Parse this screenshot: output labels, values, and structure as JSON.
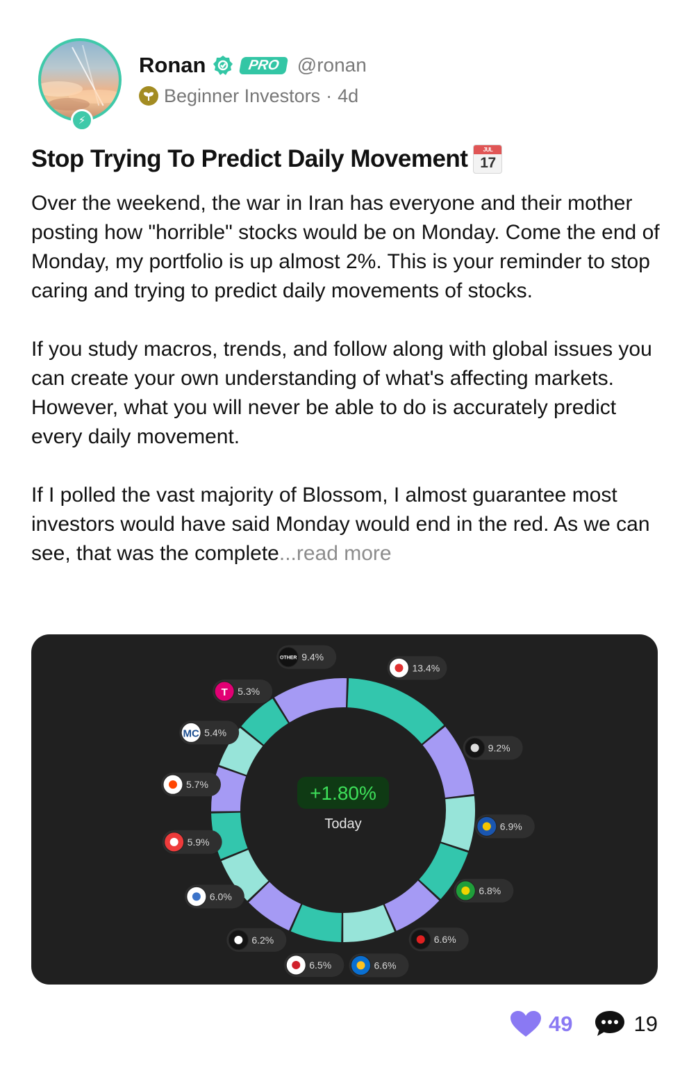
{
  "author": {
    "name": "Ronan",
    "badge": "PRO",
    "handle": "@ronan",
    "group": "Beginner Investors",
    "separator": "·",
    "age": "4d"
  },
  "post": {
    "title": "Stop Trying To Predict Daily Movement",
    "title_emoji": {
      "icon": "calendar-icon",
      "month": "JUL",
      "day": "17"
    },
    "paragraphs": [
      "Over the weekend, the war in Iran has everyone and their mother posting how \"horrible\" stocks would be on Monday. Come the end of Monday, my portfolio is up almost 2%. This is your reminder to stop caring and trying to predict daily movements of stocks.",
      "If you study macros, trends, and follow along with global issues you can create your own understanding of what's affecting markets. However, what you will never be able to do is accurately predict every daily movement.",
      "If I polled the vast majority of Blossom, I almost guarantee most investors would have said Monday would end in the red. As we can see, that was the complete"
    ],
    "read_more": "...read more"
  },
  "chart_data": {
    "type": "pie",
    "style": "donut",
    "center_value": "+1.80%",
    "center_label": "Today",
    "slices": [
      {
        "label": "13.4%",
        "value": 13.4,
        "logo": "red-swirl",
        "color": "#33c6ad"
      },
      {
        "label": "9.2%",
        "value": 9.2,
        "logo": "dark-circle",
        "color": "#a59af4"
      },
      {
        "label": "6.9%",
        "value": 6.9,
        "logo": "blue-square",
        "color": "#97e4d9"
      },
      {
        "label": "6.8%",
        "value": 6.8,
        "logo": "green-circle",
        "color": "#33c6ad"
      },
      {
        "label": "6.6%",
        "value": 6.6,
        "logo": "red-flame",
        "color": "#a59af4"
      },
      {
        "label": "6.6%",
        "value": 6.6,
        "logo": "walmart-spark",
        "color": "#97e4d9"
      },
      {
        "label": "6.5%",
        "value": 6.5,
        "logo": "red-white-logo",
        "color": "#33c6ad"
      },
      {
        "label": "6.2%",
        "value": 6.2,
        "logo": "amazon-a",
        "color": "#a59af4"
      },
      {
        "label": "6.0%",
        "value": 6.0,
        "logo": "ge-logo",
        "color": "#97e4d9"
      },
      {
        "label": "5.9%",
        "value": 5.9,
        "logo": "wsp-logo",
        "color": "#33c6ad"
      },
      {
        "label": "5.7%",
        "value": 5.7,
        "logo": "reddit-logo",
        "color": "#a59af4"
      },
      {
        "label": "5.4%",
        "value": 5.4,
        "logo": "mc-logo",
        "color": "#97e4d9",
        "logo_text": "MC"
      },
      {
        "label": "5.3%",
        "value": 5.3,
        "logo": "t-logo",
        "color": "#33c6ad",
        "logo_text": "T"
      },
      {
        "label": "9.4%",
        "value": 9.4,
        "logo": "other-logo",
        "color": "#a59af4",
        "logo_text": "OTHER"
      }
    ]
  },
  "footer": {
    "likes": "49",
    "comments": "19",
    "like_color": "#8a79f3"
  }
}
